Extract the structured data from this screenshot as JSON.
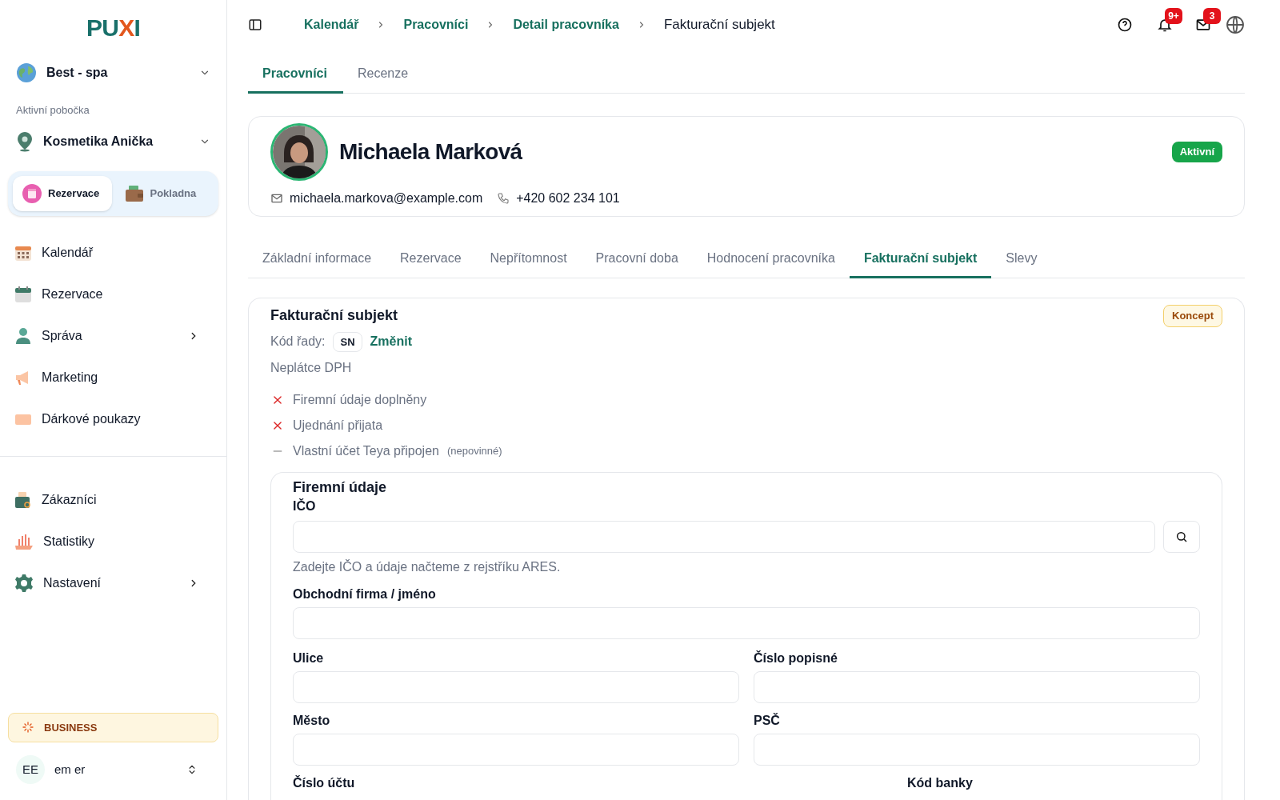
{
  "sidebar": {
    "logo": "PUXI",
    "business_selector": {
      "label": "Best - spa"
    },
    "branch_label": "Aktivní pobočka",
    "branch_selector": {
      "label": "Kosmetika Anička"
    },
    "mode_switch": [
      {
        "label": "Rezervace",
        "selected": true
      },
      {
        "label": "Pokladna",
        "selected": false
      }
    ],
    "nav_groups": [
      [
        {
          "label": "Kalendář",
          "has_submenu": false
        },
        {
          "label": "Rezervace",
          "has_submenu": false
        },
        {
          "label": "Správa",
          "has_submenu": true
        },
        {
          "label": "Marketing",
          "has_submenu": false
        },
        {
          "label": "Dárkové poukazy",
          "has_submenu": false
        }
      ],
      [
        {
          "label": "Zákazníci",
          "has_submenu": false
        },
        {
          "label": "Statistiky",
          "has_submenu": false
        },
        {
          "label": "Nastavení",
          "has_submenu": true
        }
      ]
    ],
    "plan_badge": "BUSINESS",
    "user": {
      "initials": "EE",
      "name": "em er"
    }
  },
  "header": {
    "breadcrumbs": [
      "Kalendář",
      "Pracovníci",
      "Detail pracovníka",
      "Fakturační subjekt"
    ],
    "notifications_count": "9+",
    "messages_count": "3"
  },
  "top_tabs": [
    {
      "label": "Pracovníci",
      "selected": true
    },
    {
      "label": "Recenze",
      "selected": false
    }
  ],
  "profile": {
    "name": "Michaela Marková",
    "status": "Aktivní",
    "email": "michaela.markova@example.com",
    "phone": "+420 602 234 101"
  },
  "detail_tabs": [
    {
      "label": "Základní informace",
      "selected": false
    },
    {
      "label": "Rezervace",
      "selected": false
    },
    {
      "label": "Nepřítomnost",
      "selected": false
    },
    {
      "label": "Pracovní doba",
      "selected": false
    },
    {
      "label": "Hodnocení pracovníka",
      "selected": false
    },
    {
      "label": "Fakturační subjekt",
      "selected": true
    },
    {
      "label": "Slevy",
      "selected": false
    }
  ],
  "billing": {
    "title": "Fakturační subjekt",
    "status": "Koncept",
    "series_label": "Kód řady:",
    "series_code": "SN",
    "change_link": "Změnit",
    "vat_status": "Neplátce DPH",
    "checklist": [
      {
        "label": "Firemní údaje doplněny",
        "kind": "missing"
      },
      {
        "label": "Ujednání přijata",
        "kind": "missing"
      },
      {
        "label": "Vlastní účet Teya připojen",
        "kind": "optional",
        "note": "(nepovinné)"
      }
    ],
    "company": {
      "title": "Firemní údaje",
      "ico_label": "IČO",
      "ico_hint": "Zadejte IČO a údaje načteme z rejstříku ARES.",
      "name_field": "Obchodní firma / jméno",
      "address_fields": [
        "Ulice",
        "Číslo popisné",
        "Město",
        "PSČ"
      ],
      "bank_labels": [
        "Číslo účtu",
        "Kód banky"
      ]
    }
  }
}
